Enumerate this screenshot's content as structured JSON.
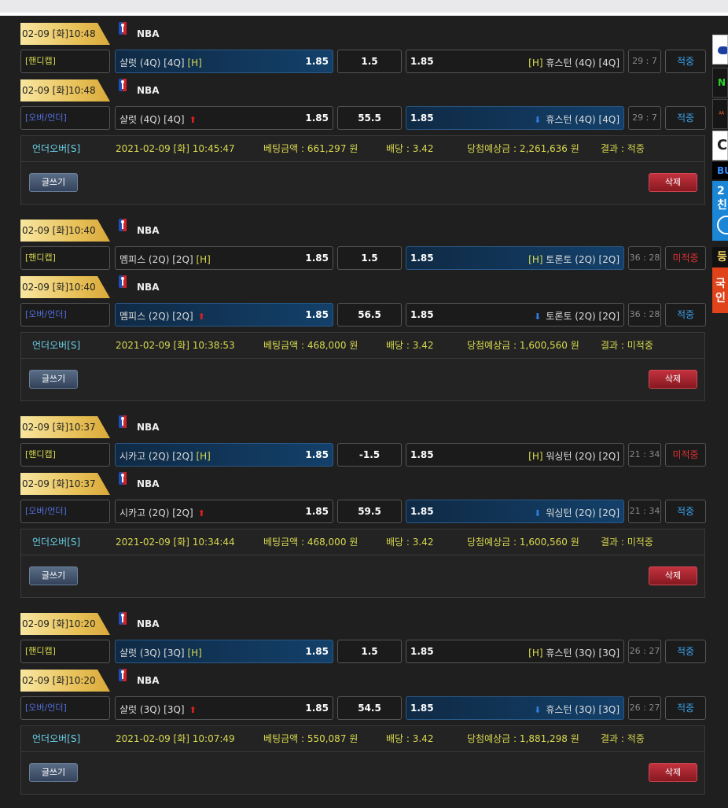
{
  "league_label": "NBA",
  "buttons": {
    "write": "글쓰기",
    "delete": "삭제"
  },
  "side_banners": [
    "",
    "N",
    "ㅆ",
    "C",
    "BU",
    "2\n친",
    "",
    "등",
    "국\n인"
  ],
  "bets": [
    {
      "games": [
        {
          "datetime": "02-09 [화]10:48",
          "type": "[핸디캡]",
          "type_color": "yellow",
          "home": "샬럿 (4Q) [4Q]",
          "home_mark": "[H]",
          "home_odds": "1.85",
          "home_arrow": "",
          "line": "1.5",
          "away_odds": "1.85",
          "away_mark": "[H]",
          "away": "휴스턴 (4Q) [4Q]",
          "away_arrow": "",
          "selected": "home",
          "score": "29 : 7",
          "result": "적중",
          "result_type": "hit"
        },
        {
          "datetime": "02-09 [화]10:48",
          "type": "[오버/언더]",
          "type_color": "blue",
          "home": "샬럿 (4Q) [4Q]",
          "home_mark": "",
          "home_odds": "1.85",
          "home_arrow": "up",
          "line": "55.5",
          "away_odds": "1.85",
          "away_mark": "",
          "away": "휴스턴 (4Q) [4Q]",
          "away_arrow": "down",
          "selected": "away",
          "score": "29 : 7",
          "result": "적중",
          "result_type": "hit"
        }
      ],
      "detail": {
        "type": "언더오버[S]",
        "time": "2021-02-09 [화] 10:45:47",
        "amount": "베팅금액 : 661,297 원",
        "odds": "배당 : 3.42",
        "expected": "당첨예상금 : 2,261,636 원",
        "result": "결과 : 적중"
      }
    },
    {
      "games": [
        {
          "datetime": "02-09 [화]10:40",
          "type": "[핸디캡]",
          "type_color": "yellow",
          "home": "멤피스 (2Q) [2Q]",
          "home_mark": "[H]",
          "home_odds": "1.85",
          "home_arrow": "",
          "line": "1.5",
          "away_odds": "1.85",
          "away_mark": "[H]",
          "away": "토론토 (2Q) [2Q]",
          "away_arrow": "",
          "selected": "away",
          "score": "36 : 28",
          "result": "미적중",
          "result_type": "miss"
        },
        {
          "datetime": "02-09 [화]10:40",
          "type": "[오버/언더]",
          "type_color": "blue",
          "home": "멤피스 (2Q) [2Q]",
          "home_mark": "",
          "home_odds": "1.85",
          "home_arrow": "up",
          "line": "56.5",
          "away_odds": "1.85",
          "away_mark": "",
          "away": "토론토 (2Q) [2Q]",
          "away_arrow": "down",
          "selected": "home",
          "score": "36 : 28",
          "result": "적중",
          "result_type": "hit"
        }
      ],
      "detail": {
        "type": "언더오버[S]",
        "time": "2021-02-09 [화] 10:38:53",
        "amount": "베팅금액 : 468,000 원",
        "odds": "배당 : 3.42",
        "expected": "당첨예상금 : 1,600,560 원",
        "result": "결과 : 미적중"
      }
    },
    {
      "games": [
        {
          "datetime": "02-09 [화]10:37",
          "type": "[핸디캡]",
          "type_color": "yellow",
          "home": "시카고 (2Q) [2Q]",
          "home_mark": "[H]",
          "home_odds": "1.85",
          "home_arrow": "",
          "line": "-1.5",
          "away_odds": "1.85",
          "away_mark": "[H]",
          "away": "워싱턴 (2Q) [2Q]",
          "away_arrow": "",
          "selected": "home",
          "score": "21 : 34",
          "result": "미적중",
          "result_type": "miss"
        },
        {
          "datetime": "02-09 [화]10:37",
          "type": "[오버/언더]",
          "type_color": "blue",
          "home": "시카고 (2Q) [2Q]",
          "home_mark": "",
          "home_odds": "1.85",
          "home_arrow": "up",
          "line": "59.5",
          "away_odds": "1.85",
          "away_mark": "",
          "away": "워싱턴 (2Q) [2Q]",
          "away_arrow": "down",
          "selected": "away",
          "score": "21 : 34",
          "result": "적중",
          "result_type": "hit"
        }
      ],
      "detail": {
        "type": "언더오버[S]",
        "time": "2021-02-09 [화] 10:34:44",
        "amount": "베팅금액 : 468,000 원",
        "odds": "배당 : 3.42",
        "expected": "당첨예상금 : 1,600,560 원",
        "result": "결과 : 미적중"
      }
    },
    {
      "games": [
        {
          "datetime": "02-09 [화]10:20",
          "type": "[핸디캡]",
          "type_color": "yellow",
          "home": "샬럿 (3Q) [3Q]",
          "home_mark": "[H]",
          "home_odds": "1.85",
          "home_arrow": "",
          "line": "1.5",
          "away_odds": "1.85",
          "away_mark": "[H]",
          "away": "휴스턴 (3Q) [3Q]",
          "away_arrow": "",
          "selected": "home",
          "score": "26 : 27",
          "result": "적중",
          "result_type": "hit"
        },
        {
          "datetime": "02-09 [화]10:20",
          "type": "[오버/언더]",
          "type_color": "blue",
          "home": "샬럿 (3Q) [3Q]",
          "home_mark": "",
          "home_odds": "1.85",
          "home_arrow": "up",
          "line": "54.5",
          "away_odds": "1.85",
          "away_mark": "",
          "away": "휴스턴 (3Q) [3Q]",
          "away_arrow": "down",
          "selected": "away",
          "score": "26 : 27",
          "result": "적중",
          "result_type": "hit"
        }
      ],
      "detail": {
        "type": "언더오버[S]",
        "time": "2021-02-09 [화] 10:07:49",
        "amount": "베팅금액 : 550,087 원",
        "odds": "배당 : 3.42",
        "expected": "당첨예상금 : 1,881,298 원",
        "result": "결과 : 적중"
      }
    }
  ]
}
